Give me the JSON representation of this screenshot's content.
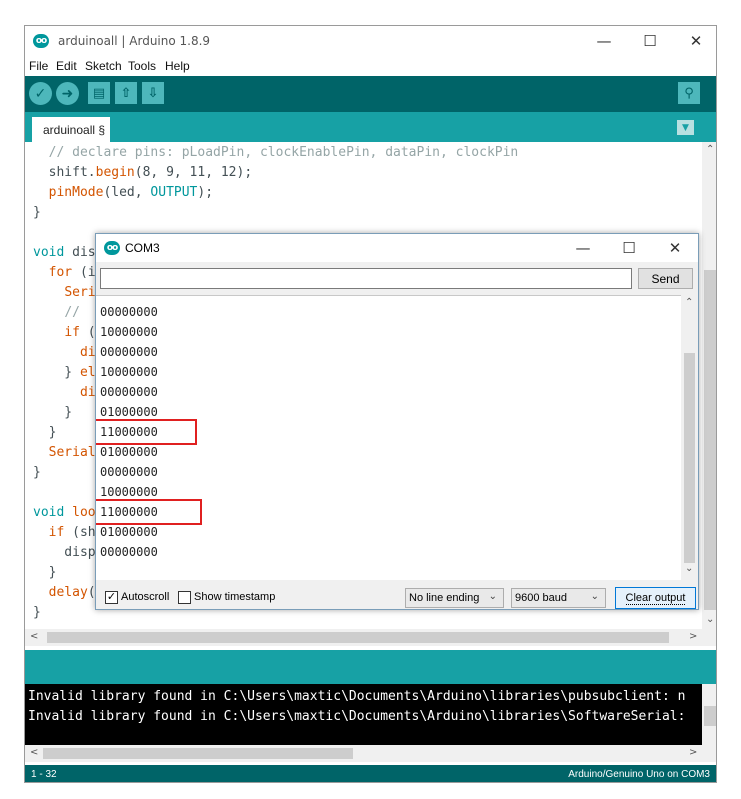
{
  "ide": {
    "title": "arduinoall | Arduino 1.8.9",
    "menu": [
      "File",
      "Edit",
      "Sketch",
      "Tools",
      "Help"
    ],
    "tab_label": "arduinoall §",
    "code_lines": [
      {
        "segs": [
          {
            "t": "  "
          },
          {
            "t": "// declare pins: pLoadPin, clockEnablePin, dataPin, clockPin",
            "c": "cm"
          }
        ]
      },
      {
        "segs": [
          {
            "t": "  shift."
          },
          {
            "t": "begin",
            "c": "kw"
          },
          {
            "t": "(8, 9, 11, 12);"
          }
        ]
      },
      {
        "segs": [
          {
            "t": "  "
          },
          {
            "t": "pinMode",
            "c": "kw"
          },
          {
            "t": "(led, "
          },
          {
            "t": "OUTPUT",
            "c": "ty"
          },
          {
            "t": ");"
          }
        ]
      },
      {
        "segs": [
          {
            "t": "}"
          }
        ]
      },
      {
        "segs": [
          {
            "t": ""
          }
        ]
      },
      {
        "segs": [
          {
            "t": "void",
            "c": "ty"
          },
          {
            "t": " dis"
          }
        ]
      },
      {
        "segs": [
          {
            "t": "  "
          },
          {
            "t": "for",
            "c": "kw"
          },
          {
            "t": " (i"
          }
        ]
      },
      {
        "segs": [
          {
            "t": "    "
          },
          {
            "t": "Seri",
            "c": "kw"
          }
        ]
      },
      {
        "segs": [
          {
            "t": "    "
          },
          {
            "t": "// ",
            "c": "cm"
          }
        ]
      },
      {
        "segs": [
          {
            "t": "    "
          },
          {
            "t": "if",
            "c": "kw"
          },
          {
            "t": " ("
          }
        ]
      },
      {
        "segs": [
          {
            "t": "      "
          },
          {
            "t": "di",
            "c": "kw"
          }
        ]
      },
      {
        "segs": [
          {
            "t": "    } "
          },
          {
            "t": "el",
            "c": "kw"
          }
        ]
      },
      {
        "segs": [
          {
            "t": "      "
          },
          {
            "t": "di",
            "c": "kw"
          }
        ]
      },
      {
        "segs": [
          {
            "t": "    }"
          }
        ]
      },
      {
        "segs": [
          {
            "t": "  }"
          }
        ]
      },
      {
        "segs": [
          {
            "t": "  "
          },
          {
            "t": "Serial",
            "c": "kw"
          }
        ]
      },
      {
        "segs": [
          {
            "t": "}"
          }
        ]
      },
      {
        "segs": [
          {
            "t": ""
          }
        ]
      },
      {
        "segs": [
          {
            "t": "void",
            "c": "ty"
          },
          {
            "t": " "
          },
          {
            "t": "loo",
            "c": "kw"
          }
        ]
      },
      {
        "segs": [
          {
            "t": "  "
          },
          {
            "t": "if",
            "c": "kw"
          },
          {
            "t": " (sh"
          }
        ]
      },
      {
        "segs": [
          {
            "t": "    disp"
          }
        ]
      },
      {
        "segs": [
          {
            "t": "  }"
          }
        ]
      },
      {
        "segs": [
          {
            "t": "  "
          },
          {
            "t": "delay",
            "c": "kw"
          },
          {
            "t": "("
          }
        ]
      },
      {
        "segs": [
          {
            "t": "}"
          }
        ]
      }
    ],
    "console_lines": [
      "Invalid library found in C:\\Users\\maxtic\\Documents\\Arduino\\libraries\\pubsubclient: n",
      "Invalid library found in C:\\Users\\maxtic\\Documents\\Arduino\\libraries\\SoftwareSerial:"
    ],
    "status_line": "1 - 32",
    "status_board": "Arduino/Genuino Uno on COM3"
  },
  "serial": {
    "title": "COM3",
    "input_value": "",
    "send_label": "Send",
    "output_lines": [
      "00000000",
      "10000000",
      "00000000",
      "10000000",
      "00000000",
      "01000000",
      "11000000",
      "01000000",
      "00000000",
      "10000000",
      "11000000",
      "01000000",
      "00000000"
    ],
    "highlighted_lines": [
      6,
      10
    ],
    "autoscroll_label": "Autoscroll",
    "autoscroll_checked": true,
    "timestamp_label": "Show timestamp",
    "timestamp_checked": false,
    "line_ending": "No line ending",
    "baud": "9600 baud",
    "clear_label": "Clear output"
  },
  "colors": {
    "toolbar": "#006468",
    "tabbar": "#17a1a5",
    "highlight_box": "#e02020"
  }
}
